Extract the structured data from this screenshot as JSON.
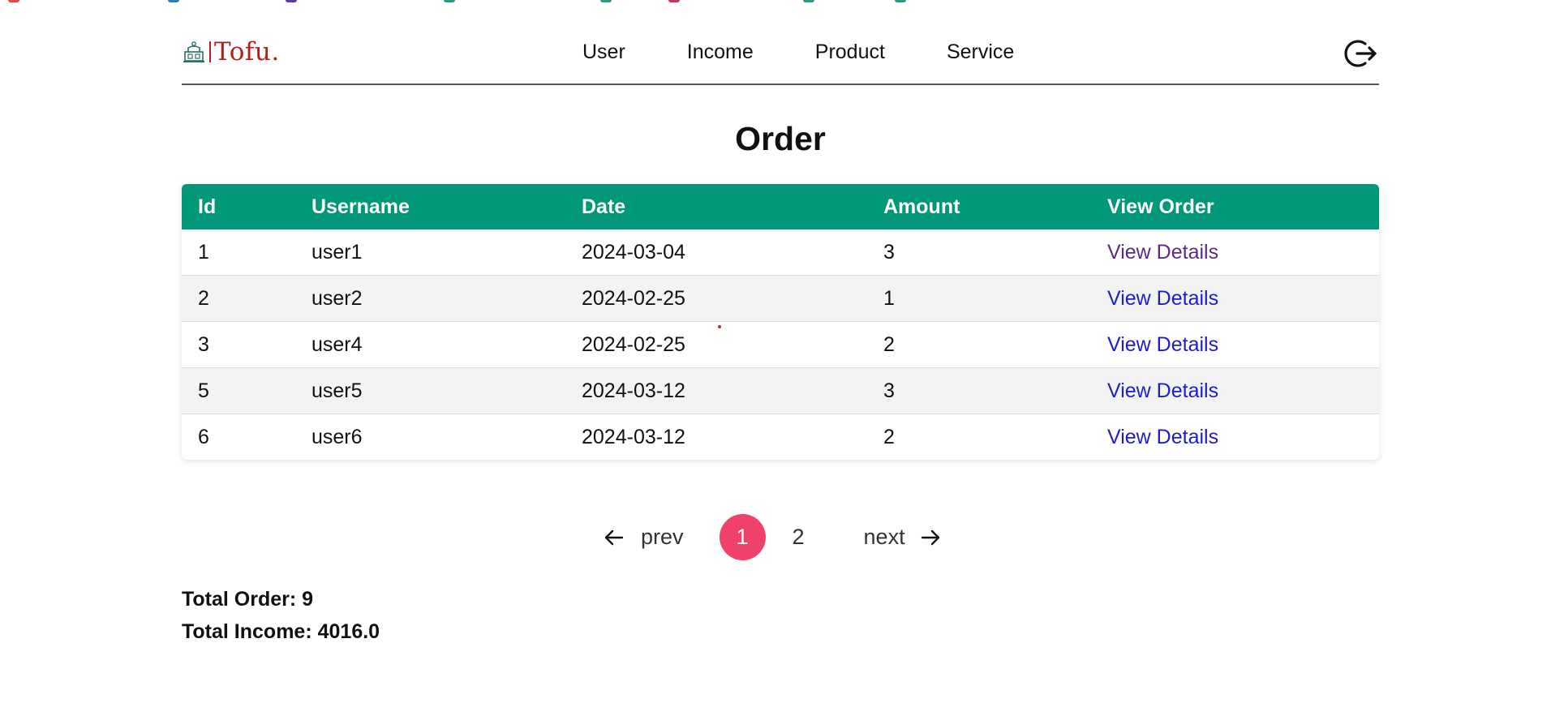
{
  "brand": {
    "name": "Tofu.",
    "logo_icon": "bakery-stall-icon",
    "color": "#b91c1c"
  },
  "nav": {
    "items": [
      {
        "label": "User"
      },
      {
        "label": "Income"
      },
      {
        "label": "Product"
      },
      {
        "label": "Service"
      }
    ],
    "logout_icon": "logout-icon"
  },
  "page": {
    "title": "Order"
  },
  "table": {
    "header_color": "#009879",
    "columns": [
      "Id",
      "Username",
      "Date",
      "Amount",
      "View Order"
    ],
    "rows": [
      {
        "id": "1",
        "username": "user1",
        "date": "2024-03-04",
        "amount": "3",
        "link": "View Details",
        "visited": true
      },
      {
        "id": "2",
        "username": "user2",
        "date": "2024-02-25",
        "amount": "1",
        "link": "View Details",
        "visited": false
      },
      {
        "id": "3",
        "username": "user4",
        "date": "2024-02-25",
        "amount": "2",
        "link": "View Details",
        "visited": false
      },
      {
        "id": "5",
        "username": "user5",
        "date": "2024-03-12",
        "amount": "3",
        "link": "View Details",
        "visited": false
      },
      {
        "id": "6",
        "username": "user6",
        "date": "2024-03-12",
        "amount": "2",
        "link": "View Details",
        "visited": false
      }
    ]
  },
  "pagination": {
    "prev_label": "prev",
    "next_label": "next",
    "pages": [
      "1",
      "2"
    ],
    "current": "1",
    "active_color": "#f0416b"
  },
  "totals": {
    "order": "Total Order: 9",
    "income": "Total Income: 4016.0"
  }
}
